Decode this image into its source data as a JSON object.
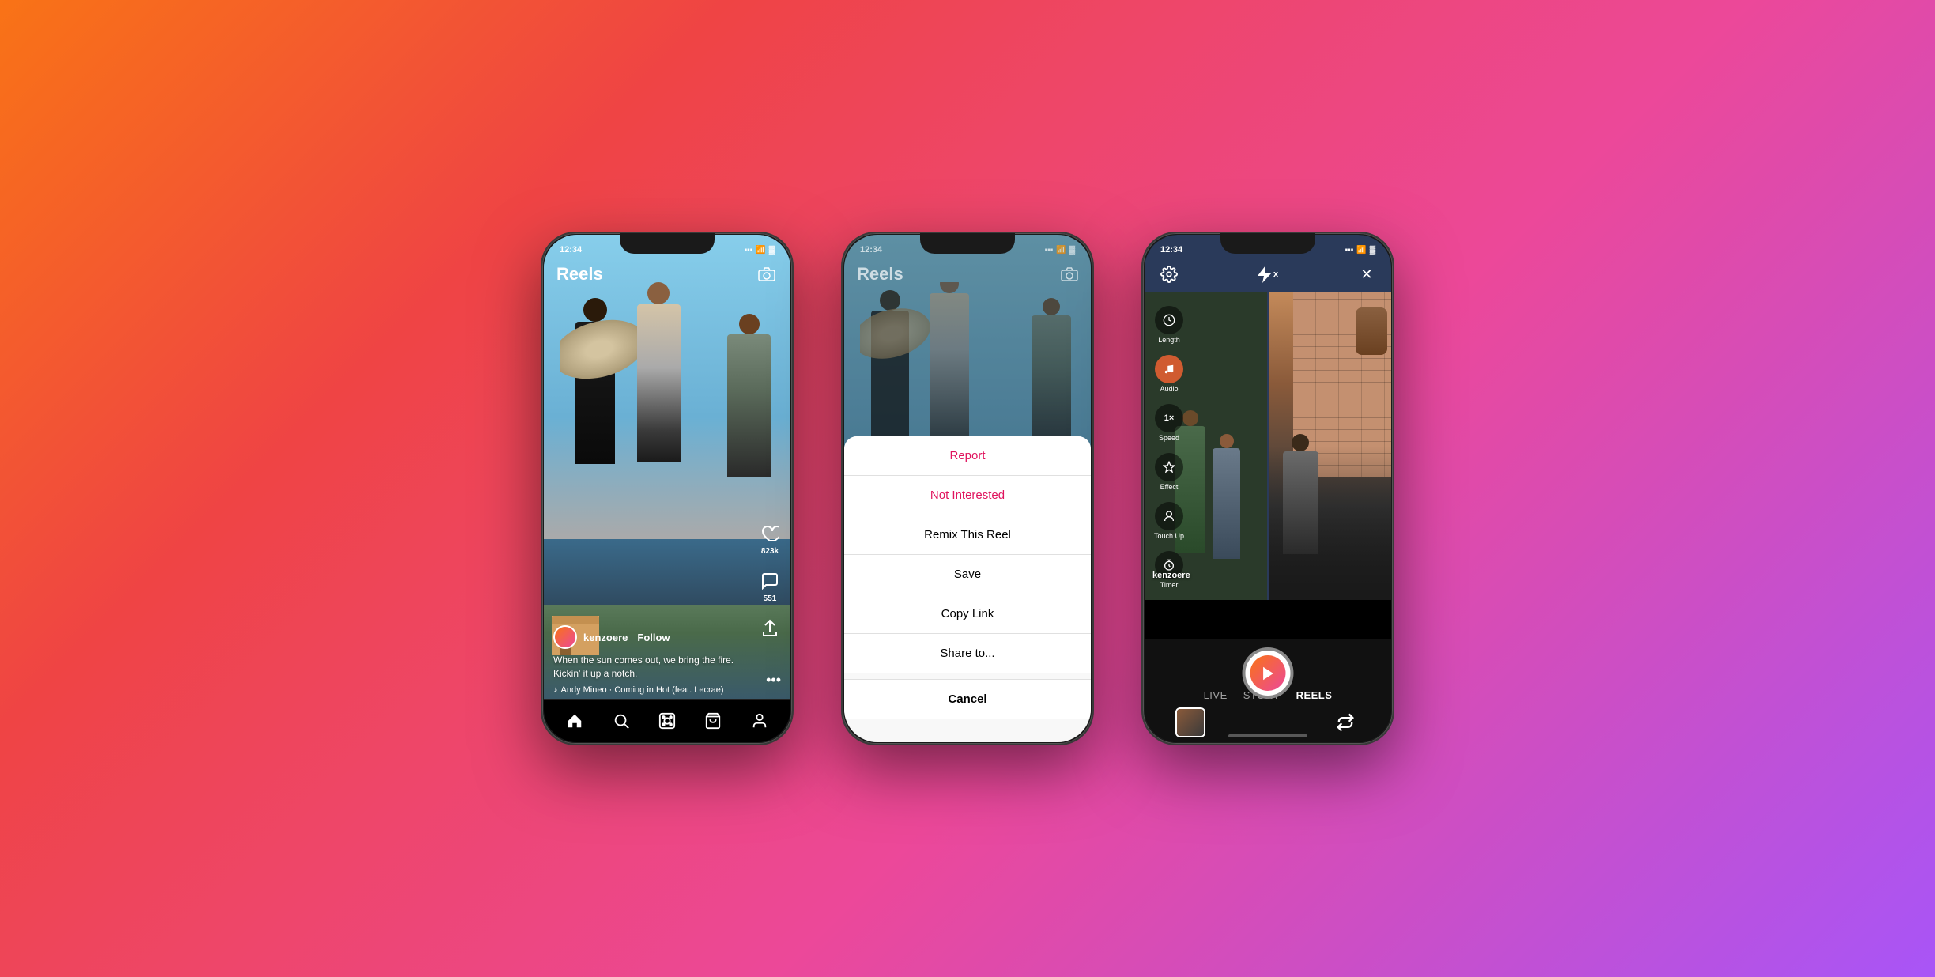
{
  "background": {
    "gradient": "135deg, #f97316 0%, #ef4444 25%, #ec4899 60%, #a855f7 100%"
  },
  "phone1": {
    "status_time": "12:34",
    "header_title": "Reels",
    "likes": "823k",
    "comments": "551",
    "user": "kenzoere",
    "follow": "Follow",
    "caption": "When the sun comes out, we bring the fire.\nKickin' it up a notch.",
    "audio": "Andy Mineo · Coming in Hot (feat. Lecrae)",
    "nav": [
      "home",
      "search",
      "reels",
      "shop",
      "profile"
    ]
  },
  "phone2": {
    "status_time": "12:34",
    "header_title": "Reels",
    "sheet_items": [
      {
        "label": "Report",
        "style": "red"
      },
      {
        "label": "Not Interested",
        "style": "red"
      },
      {
        "label": "Remix This Reel",
        "style": "normal"
      },
      {
        "label": "Save",
        "style": "normal"
      },
      {
        "label": "Copy Link",
        "style": "normal"
      },
      {
        "label": "Share to...",
        "style": "normal"
      }
    ],
    "cancel_label": "Cancel"
  },
  "phone3": {
    "status_time": "12:34",
    "header_settings": "⚙",
    "header_flash": "⚡",
    "header_close": "✕",
    "controls": [
      {
        "icon": "⏱",
        "label": "Length"
      },
      {
        "icon": "🎵",
        "label": "Audio"
      },
      {
        "icon": "1×",
        "label": "Speed"
      },
      {
        "icon": "✨",
        "label": "Effect"
      },
      {
        "icon": "👁",
        "label": "Touch Up"
      },
      {
        "icon": "⏰",
        "label": "Timer"
      }
    ],
    "preview_username": "kenzoere",
    "tabs": [
      {
        "label": "LIVE",
        "active": false
      },
      {
        "label": "STORY",
        "active": false
      },
      {
        "label": "REELS",
        "active": true
      }
    ]
  }
}
